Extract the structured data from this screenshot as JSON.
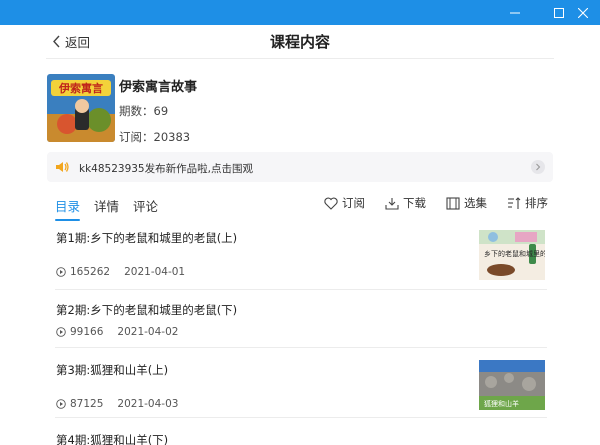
{
  "window": {
    "accent": "#1e8fe6"
  },
  "header": {
    "back_label": "返回",
    "title": "课程内容"
  },
  "course": {
    "title": "伊索寓言故事",
    "cover_text": "伊索寓言",
    "episodes": "期数：69",
    "subscribers": "订阅：20383"
  },
  "notice": {
    "text": "kk48523935发布新作品啦,点击围观"
  },
  "tabs": [
    {
      "label": "目录",
      "active": true
    },
    {
      "label": "详情",
      "active": false
    },
    {
      "label": "评论",
      "active": false
    }
  ],
  "actions": {
    "subscribe": "订阅",
    "download": "下载",
    "select": "选集",
    "sort": "排序"
  },
  "episodes": [
    {
      "title": "第1期:乡下的老鼠和城里的老鼠(上)",
      "plays": "165262",
      "date": "2021-04-01",
      "thumb_text": "乡下的老鼠和城里的老鼠"
    },
    {
      "title": "第2期:乡下的老鼠和城里的老鼠(下)",
      "plays": "99166",
      "date": "2021-04-02"
    },
    {
      "title": "第3期:狐狸和山羊(上)",
      "plays": "87125",
      "date": "2021-04-03",
      "thumb_text": "狐狸和山羊"
    },
    {
      "title": "第4期:狐狸和山羊(下)"
    }
  ]
}
